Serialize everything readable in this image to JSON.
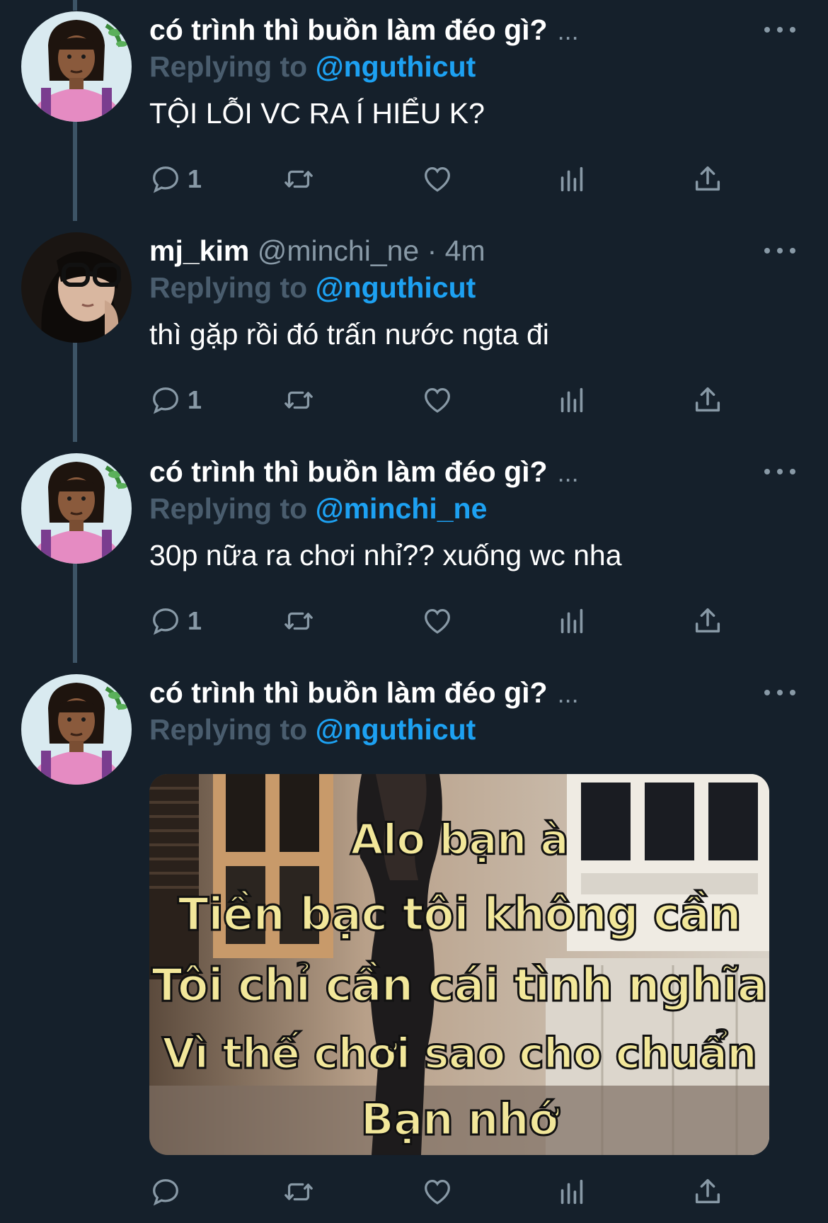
{
  "tweets": [
    {
      "name": "có trình thì buồn làm đéo gì?",
      "handle": "",
      "truncation": "...",
      "replying_prefix": "Replying to",
      "replying_to": "@nguthicut",
      "text": "TỘI LỖI VC RA Í HIỂU K?",
      "reply_count": "1",
      "avatar": "pink-shirt-haircut-avatar"
    },
    {
      "name": "mj_kim",
      "handle": "@minchi_ne · 4m",
      "truncation": "",
      "replying_prefix": "Replying to",
      "replying_to": "@nguthicut",
      "text": "thì gặp rồi đó trấn nước ngta đi",
      "reply_count": "1",
      "avatar": "glasses-girl-avatar"
    },
    {
      "name": "có trình thì buồn làm đéo gì?",
      "handle": "",
      "truncation": "...",
      "replying_prefix": "Replying to",
      "replying_to": "@minchi_ne",
      "text": "30p nữa ra chơi nhỉ?? xuống wc nha",
      "reply_count": "1",
      "avatar": "pink-shirt-haircut-avatar"
    },
    {
      "name": "có trình thì buồn làm đéo gì?",
      "handle": "",
      "truncation": "...",
      "replying_prefix": "Replying to",
      "replying_to": "@nguthicut",
      "text": "",
      "reply_count": "",
      "avatar": "pink-shirt-haircut-avatar",
      "media_caption": [
        "Alo bạn à",
        "Tiền bạc tôi không cần",
        "Tôi chỉ cần cái tình nghĩa",
        "Vì thế chơi sao cho chuẩn",
        "Bạn nhớ"
      ]
    }
  ],
  "colors": {
    "background": "#15202b",
    "secondary_text": "#8899a6",
    "mention": "#1da1f2",
    "thread_line": "#3d5466"
  },
  "action_icons": [
    "reply-icon",
    "retweet-icon",
    "like-icon",
    "analytics-icon",
    "share-icon"
  ]
}
